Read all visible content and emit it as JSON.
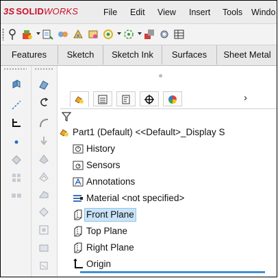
{
  "app": {
    "brand_prefix": "3S",
    "brand_bold": "SOLID",
    "brand_rest": "WORKS"
  },
  "menu": [
    "File",
    "Edit",
    "View",
    "Insert",
    "Tools",
    "Windo"
  ],
  "command_tabs": [
    "Features",
    "Sketch",
    "Sketch Ink",
    "Surfaces",
    "Sheet Metal"
  ],
  "panel_tabs": [
    "feature-manager-icon",
    "property-manager-icon",
    "configuration-manager-icon",
    "dimxpert-icon",
    "display-manager-icon"
  ],
  "panel_more": "›",
  "tree": {
    "root": "Part1 (Default) <<Default>_Display S",
    "items": [
      {
        "label": "History",
        "icon": "history-icon"
      },
      {
        "label": "Sensors",
        "icon": "sensors-icon"
      },
      {
        "label": "Annotations",
        "icon": "annotations-icon"
      },
      {
        "label": "Material <not specified>",
        "icon": "material-icon"
      },
      {
        "label": "Front Plane",
        "icon": "plane-icon"
      },
      {
        "label": "Top Plane",
        "icon": "plane-icon"
      },
      {
        "label": "Right Plane",
        "icon": "plane-icon"
      },
      {
        "label": "Origin",
        "icon": "origin-icon"
      }
    ],
    "selected": "Front Plane"
  },
  "colors": {
    "brand": "#c8102e",
    "selection": "#c9e4f8",
    "accent": "#3c8fd6"
  }
}
